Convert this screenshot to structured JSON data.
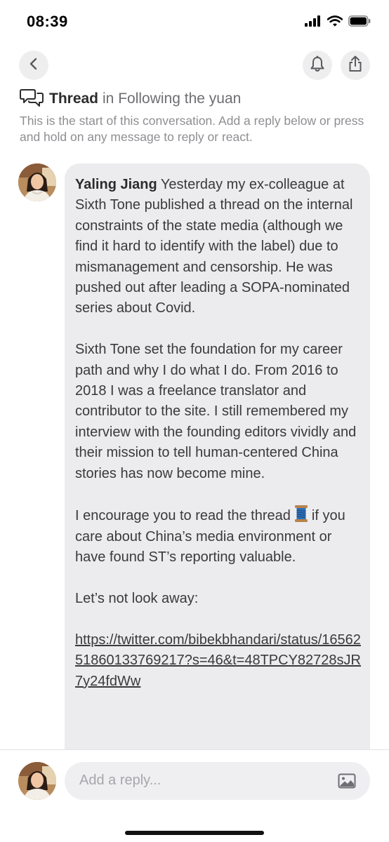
{
  "status_bar": {
    "time": "08:39",
    "icons": [
      "signal-icon",
      "wifi-icon",
      "battery-icon"
    ]
  },
  "nav": {
    "back_icon": "chevron-left-icon",
    "bell_icon": "bell-icon",
    "share_icon": "share-icon"
  },
  "thread": {
    "title": "Thread",
    "channel_prefix": "in Following the yuan",
    "intro": "This is the start of this conversation. Add a reply below or press and hold on any message to reply or react."
  },
  "message": {
    "author": "Yaling Jiang",
    "paragraph1": "Yesterday my ex-colleague at Sixth Tone published a thread on the internal constraints of the state media (although we find it hard to identify with the label) due to mismanagement and censorship. He was pushed out after leading a SOPA-nominated series about Covid.",
    "paragraph2": "Sixth Tone set the foundation for my career path and why I do what I do. From 2016 to 2018 I was a freelance translator and contributor to the site. I still remembered my interview with the founding editors vividly and their mission to tell human-centered China stories has now become mine.",
    "paragraph3_before": "I encourage you to read the thread",
    "paragraph3_emoji": "thread-spool-icon",
    "paragraph3_after": "if you care about China’s media environment or have found ST’s reporting valuable.",
    "paragraph4": "Let’s not look away:",
    "link": "https://twitter.com/bibekbhandari/status/1656251860133769217?s=46&t=48TPCY82728sJR7y24fdWw"
  },
  "composer": {
    "placeholder": "Add a reply...",
    "image_icon": "image-icon"
  },
  "colors": {
    "bubble": "#ececee",
    "button_bg": "#eeeeef",
    "muted_text": "#8e8e93"
  }
}
